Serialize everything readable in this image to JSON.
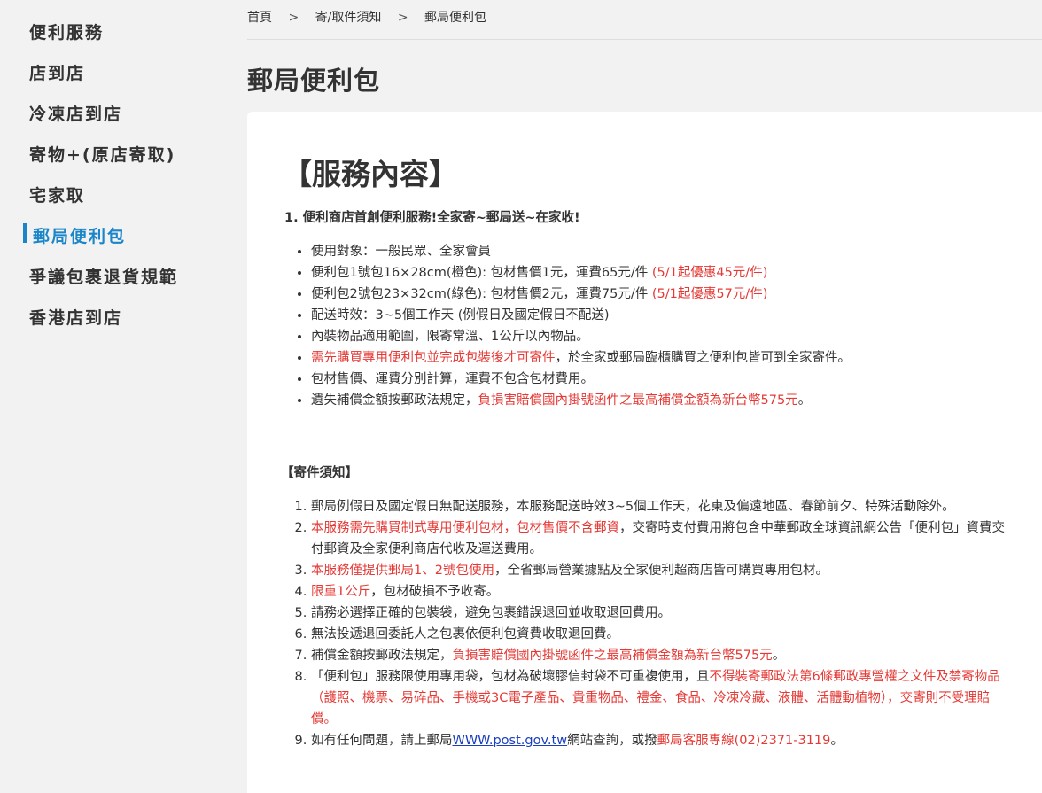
{
  "sidebar": {
    "items": [
      {
        "label": "便利服務",
        "active": false
      },
      {
        "label": "店到店",
        "active": false
      },
      {
        "label": "冷凍店到店",
        "active": false
      },
      {
        "label": "寄物+(原店寄取)",
        "active": false
      },
      {
        "label": "宅家取",
        "active": false
      },
      {
        "label": "郵局便利包",
        "active": true
      },
      {
        "label": "爭議包裹退貨規範",
        "active": false
      },
      {
        "label": "香港店到店",
        "active": false
      }
    ],
    "accent_color": "#1a85c8"
  },
  "breadcrumb": {
    "items": [
      "首頁",
      "寄/取件須知",
      "郵局便利包"
    ],
    "separator": ">"
  },
  "page_title": "郵局便利包",
  "content": {
    "section_title": "【服務內容】",
    "sub_heading": "1. 便利商店首創便利服務!全家寄~郵局送~在家收!",
    "bullets": [
      {
        "text": "使用對象：一般民眾、全家會員",
        "red": ""
      },
      {
        "text": "便利包1號包16×28cm(橙色): 包材售價1元，運費65元/件 ",
        "red": "(5/1起優惠45元/件)"
      },
      {
        "text": "便利包2號包23×32cm(綠色): 包材售價2元，運費75元/件 ",
        "red": "(5/1起優惠57元/件)"
      },
      {
        "text": "配送時效：3~5個工作天 (例假日及國定假日不配送)",
        "red": ""
      },
      {
        "text": "內裝物品適用範圍，限寄常溫、1公斤以內物品。",
        "red": ""
      },
      {
        "red_first": "需先購買專用便利包並完成包裝後才可寄件",
        "text_after": "，於全家或郵局臨櫃購買之便利包皆可到全家寄件。"
      },
      {
        "text": "包材售價、運費分別計算，運費不包含包材費用。",
        "red": ""
      },
      {
        "text": "遺失補償金額按郵政法規定，",
        "red": "負損害賠償國內掛號函件之最高補償金額為新台幣575元",
        "text_after": "。"
      }
    ],
    "notice_heading": "【寄件須知】",
    "notices": [
      {
        "parts": [
          {
            "t": "郵局例假日及國定假日無配送服務，本服務配送時效3~5個工作天，花東及偏遠地區、春節前夕、特殊活動除外。",
            "red": false
          }
        ]
      },
      {
        "parts": [
          {
            "t": "本服務需先購買制式專用便利包材，包材售價不含郵資",
            "red": true
          },
          {
            "t": "，交寄時支付費用將包含中華郵政全球資訊網公告「便利包」資費交付郵資及全家便利商店代收及運送費用。",
            "red": false
          }
        ]
      },
      {
        "parts": [
          {
            "t": "本服務僅提供郵局1、2號包使用",
            "red": true
          },
          {
            "t": "，全省郵局營業據點及全家便利超商店皆可購買專用包材。",
            "red": false
          }
        ]
      },
      {
        "parts": [
          {
            "t": "限重1公斤",
            "red": true
          },
          {
            "t": "，包材破損不予收寄。",
            "red": false
          }
        ]
      },
      {
        "parts": [
          {
            "t": "請務必選擇正確的包裝袋，避免包裹錯誤退回並收取退回費用。",
            "red": false
          }
        ]
      },
      {
        "parts": [
          {
            "t": "無法投遞退回委託人之包裹依便利包資費收取退回費。",
            "red": false
          }
        ]
      },
      {
        "parts": [
          {
            "t": "補償金額按郵政法規定，",
            "red": false
          },
          {
            "t": "負損害賠償國內掛號函件之最高補償金額為新台幣575元",
            "red": true
          },
          {
            "t": "。",
            "red": false
          }
        ]
      },
      {
        "parts": [
          {
            "t": "「便利包」服務限使用專用袋，包材為破壞膠信封袋不可重複使用，且",
            "red": false
          },
          {
            "t": "不得裝寄郵政法第6條郵政專營權之文件及禁寄物品（護照、機票、易碎品、手機或3C電子產品、貴重物品、禮金、食品、冷凍冷藏、液體、活體動植物），交寄則不受理賠償。",
            "red": true
          }
        ]
      },
      {
        "parts": [
          {
            "t": "如有任何問題，請上郵局",
            "red": false
          },
          {
            "t": "WWW.post.gov.tw",
            "link": true
          },
          {
            "t": "網站查詢，或撥",
            "red": false
          },
          {
            "t": "郵局客服專線(02)2371-3119",
            "red": true
          },
          {
            "t": "。",
            "red": false
          }
        ]
      }
    ]
  },
  "colors": {
    "red": "#e53935",
    "link": "#1a3fbf",
    "accent": "#1a85c8"
  }
}
